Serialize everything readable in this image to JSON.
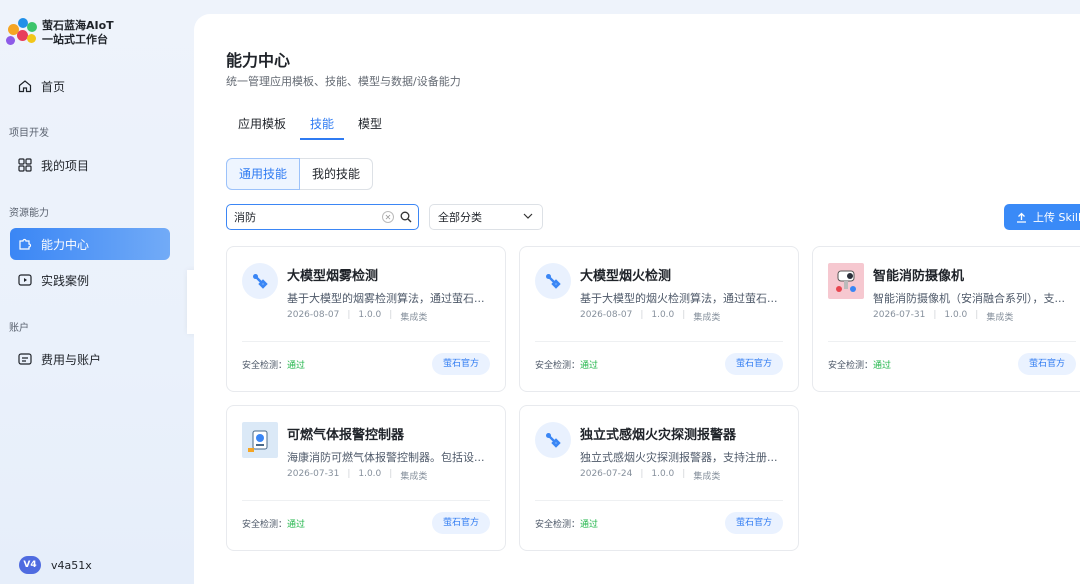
{
  "app": {
    "name_line1": "萤石蓝海AIoT",
    "name_line2": "一站式工作台"
  },
  "sidebar": {
    "home": "首页",
    "section_project": "项目开发",
    "my_projects": "我的项目",
    "section_resources": "资源能力",
    "capability_center": "能力中心",
    "practice_cases": "实践案例",
    "section_account": "账户",
    "billing": "费用与账户"
  },
  "user": {
    "avatar_text": "V4",
    "name": "v4a51x"
  },
  "main": {
    "title": "能力中心",
    "subtitle": "统一管理应用模板、技能、模型与数据/设备能力",
    "tabs": [
      "应用模板",
      "技能",
      "模型"
    ],
    "active_tab": "技能",
    "segments": [
      "通用技能",
      "我的技能"
    ],
    "search_value": "消防",
    "category_select": "全部分类",
    "upload_label": "上传 Skill"
  },
  "cards": [
    {
      "title": "大模型烟雾检测",
      "desc": "基于大模型的烟雾检测算法，通过萤石...",
      "date": "2026-08-07",
      "version": "1.0.0",
      "category": "集成类",
      "safety_label": "安全检测：",
      "safety_status": "通过",
      "badge": "萤石官方",
      "icon": "wrench-icon"
    },
    {
      "title": "大模型烟火检测",
      "desc": "基于大模型的烟火检测算法，通过萤石...",
      "date": "2026-08-07",
      "version": "1.0.0",
      "category": "集成类",
      "safety_label": "安全检测：",
      "safety_status": "通过",
      "badge": "萤石官方",
      "icon": "wrench-icon"
    },
    {
      "title": "智能消防摄像机",
      "desc": "智能消防摄像机（安消融合系列），支...",
      "date": "2026-07-31",
      "version": "1.0.0",
      "category": "集成类",
      "safety_label": "安全检测：",
      "safety_status": "通过",
      "badge": "萤石官方",
      "icon": "camera-icon"
    },
    {
      "title": "可燃气体报警控制器",
      "desc": "海康消防可燃气体报警控制器。包括设...",
      "date": "2026-07-31",
      "version": "1.0.0",
      "category": "集成类",
      "safety_label": "安全检测：",
      "safety_status": "通过",
      "badge": "萤石官方",
      "icon": "gas-detector-icon"
    },
    {
      "title": "独立式感烟火灾探测报警器",
      "desc": "独立式感烟火灾探测报警器，支持注册...",
      "date": "2026-07-24",
      "version": "1.0.0",
      "category": "集成类",
      "safety_label": "安全检测：",
      "safety_status": "通过",
      "badge": "萤石官方",
      "icon": "wrench-icon"
    }
  ],
  "colors": {
    "accent": "#2f7bf2",
    "nav_active": "#3a86f5",
    "success": "#21b64a"
  }
}
